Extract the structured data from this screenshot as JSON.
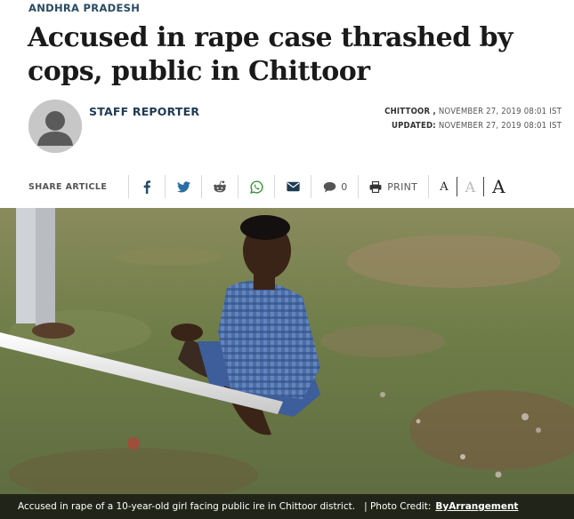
{
  "section": "ANDHRA PRADESH",
  "headline": "Accused in rape case thrashed by cops, public in Chittoor",
  "author": "STAFF REPORTER",
  "dateline": {
    "place": "CHITTOOR ,",
    "published": "NOVEMBER 27, 2019 08:01 IST",
    "updated_label": "UPDATED:",
    "updated": "NOVEMBER 27, 2019 08:01 IST"
  },
  "share": {
    "label": "SHARE ARTICLE",
    "icons": [
      "facebook-icon",
      "twitter-icon",
      "reddit-icon",
      "whatsapp-icon",
      "email-icon",
      "comment-icon"
    ],
    "comment_count": "0",
    "print_label": "PRINT",
    "font_sizes": [
      "A",
      "A",
      "A"
    ]
  },
  "photo": {
    "caption": "Accused in rape of a 10-year-old girl facing public ire in Chittoor district.",
    "credit_label": "| Photo Credit:",
    "credit": "ByArrangement"
  },
  "colors": {
    "section": "#2a4b63",
    "author": "#1f3b52",
    "avatar": "#c7c7c7",
    "caption_bg": "#0a0a0a"
  }
}
